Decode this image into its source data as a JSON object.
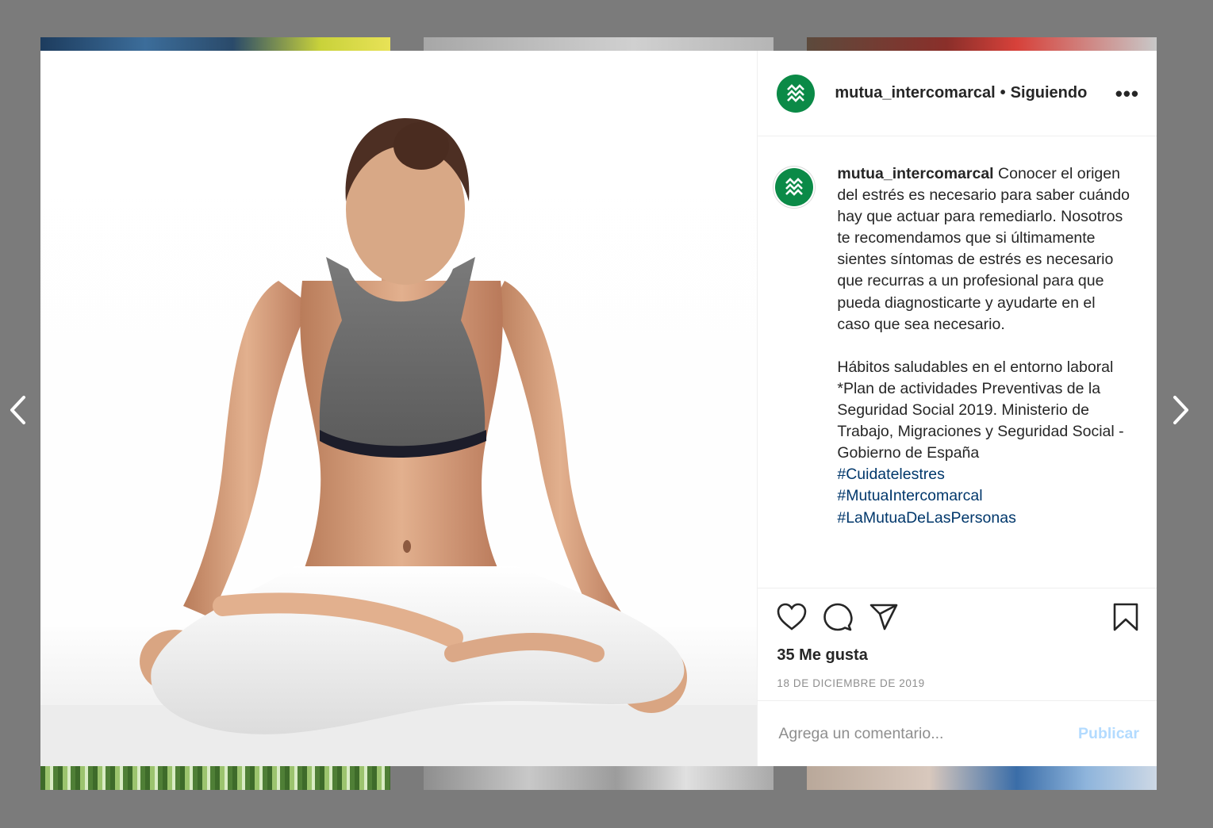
{
  "post": {
    "username": "mutua_intercomarcal",
    "follow_status": "Siguiendo",
    "separator": "•",
    "more_icon": "•••",
    "caption_user": "mutua_intercomarcal",
    "caption_body": " Conocer el origen del estrés es necesario para saber cuándo hay que actuar para remediarlo. Nosotros te recomendamos que si últimamente sientes síntomas de estrés es necesario que recurras a un profesional para que pueda diagnosticarte y ayudarte en el caso que sea necesario.\n\nHábitos saludables en el entorno laboral\n*Plan de actividades Preventivas de la Seguridad Social 2019. Ministerio de Trabajo, Migraciones y Seguridad Social - Gobierno de España\n",
    "hashtags": [
      "#Cuidatelestres",
      "#MutuaIntercomarcal",
      "#LaMutuaDeLasPersonas"
    ],
    "likes": "35 Me gusta",
    "date": "18 DE DICIEMBRE DE 2019",
    "comment_placeholder": "Agrega un comentario...",
    "publish_label": "Publicar"
  },
  "icons": {
    "like": "heart-icon",
    "comment": "comment-icon",
    "share": "share-icon",
    "save": "bookmark-icon",
    "prev": "chevron-left-icon",
    "next": "chevron-right-icon"
  },
  "colors": {
    "brand_green": "#0b8a47",
    "hashtag": "#00376b",
    "publish_disabled": "#b3dbff",
    "overlay": "#7b7b7b"
  }
}
